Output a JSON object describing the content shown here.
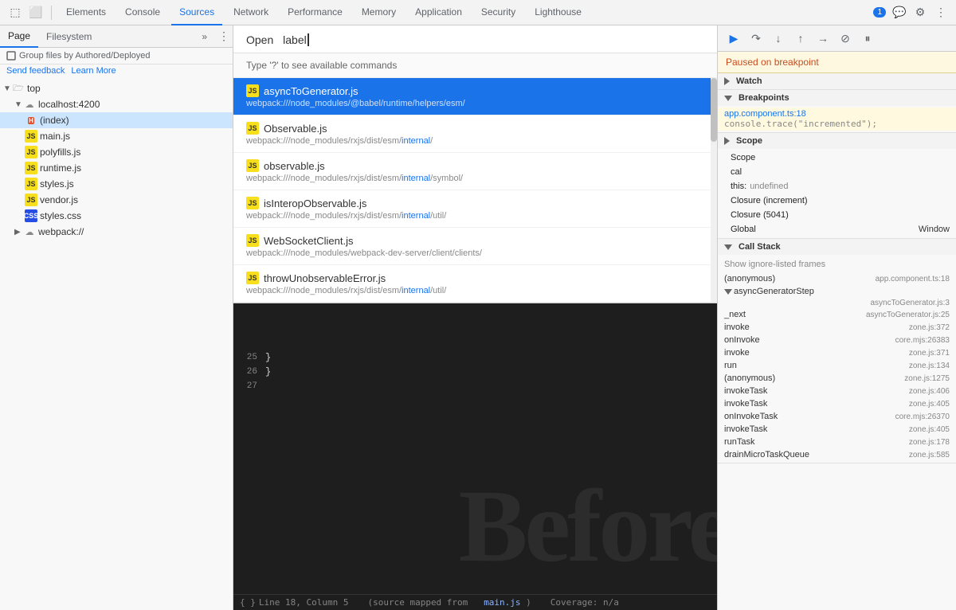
{
  "toolbar": {
    "tabs": [
      "Elements",
      "Console",
      "Sources",
      "Network",
      "Performance",
      "Memory",
      "Application",
      "Security",
      "Lighthouse"
    ],
    "active_tab": "Sources",
    "icons": {
      "inspect": "⬚",
      "device": "⬜",
      "settings": "⚙",
      "more": "⋮",
      "chat_badge": "1"
    }
  },
  "sidebar": {
    "tabs": [
      "Page",
      "Filesystem"
    ],
    "group_label": "Group files by Authored/Deployed",
    "send_feedback": "Send feedback",
    "learn_more": "Learn More",
    "tree": [
      {
        "id": "top",
        "label": "top",
        "level": 0,
        "type": "folder",
        "expanded": true
      },
      {
        "id": "localhost",
        "label": "localhost:4200",
        "level": 1,
        "type": "cloud",
        "expanded": true
      },
      {
        "id": "index",
        "label": "(index)",
        "level": 2,
        "type": "html",
        "selected": true
      },
      {
        "id": "main",
        "label": "main.js",
        "level": 2,
        "type": "js"
      },
      {
        "id": "polyfills",
        "label": "polyfills.js",
        "level": 2,
        "type": "js"
      },
      {
        "id": "runtime",
        "label": "runtime.js",
        "level": 2,
        "type": "js"
      },
      {
        "id": "styles",
        "label": "styles.js",
        "level": 2,
        "type": "js"
      },
      {
        "id": "vendor",
        "label": "vendor.js",
        "level": 2,
        "type": "js"
      },
      {
        "id": "stylescss",
        "label": "styles.css",
        "level": 2,
        "type": "css"
      },
      {
        "id": "webpack",
        "label": "webpack://",
        "level": 1,
        "type": "cloud",
        "expanded": false
      }
    ]
  },
  "file_open": {
    "label_open": "Open",
    "label_query": "label",
    "hint": "Type '?' to see available commands",
    "files": [
      {
        "name": "asyncToGenerator.js",
        "path": "webpack:///node_modules/@babel/runtime/helpers/esm/",
        "path_highlight": "",
        "selected": true
      },
      {
        "name": "Observable.js",
        "path": "webpack:///node_modules/rxjs/dist/esm/internal/",
        "path_highlight": "internal",
        "selected": false
      },
      {
        "name": "observable.js",
        "path": "webpack:///node_modules/rxjs/dist/esm/internal/symbol/",
        "path_highlight": "internal",
        "selected": false
      },
      {
        "name": "isInteropObservable.js",
        "path": "webpack:///node_modules/rxjs/dist/esm/internal/util/",
        "path_highlight": "internal",
        "selected": false
      },
      {
        "name": "WebSocketClient.js",
        "path": "webpack:///node_modules/webpack-dev-server/client/clients/",
        "path_highlight": "",
        "selected": false
      },
      {
        "name": "throwUnobservableError.js",
        "path": "webpack:///node_modules/rxjs/dist/esm/internal/util/",
        "path_highlight": "internal",
        "selected": false
      }
    ]
  },
  "source_code": {
    "lines": [
      {
        "num": "25",
        "code": "  }"
      },
      {
        "num": "26",
        "code": "}"
      },
      {
        "num": "27",
        "code": ""
      }
    ]
  },
  "status_bar": {
    "position": "Line 18, Column 5",
    "source_map": "(source mapped from",
    "source_file": "main.js",
    "coverage": "Coverage: n/a",
    "line_col": "{ }"
  },
  "debugger": {
    "paused_label": "Paused on breakpoint",
    "controls": [
      "resume",
      "step-over",
      "step-into",
      "step-out",
      "step",
      "deactivate",
      "pause"
    ],
    "sections": {
      "watch": {
        "label": "Watch"
      },
      "breakpoints": {
        "label": "Breakpoints",
        "items": [
          {
            "file": "app.component.ts:18",
            "code": "console.trace(\"incremented\");"
          }
        ]
      },
      "scope": {
        "label": "Scope",
        "items": [
          {
            "label": "Scope",
            "value": ""
          },
          {
            "label": "cal",
            "value": ""
          },
          {
            "label": "this:",
            "value": "undefined"
          },
          {
            "label": "Closure (increment)",
            "value": ""
          },
          {
            "label": "Closure (5041)",
            "value": ""
          },
          {
            "label": "Global",
            "value": "Window",
            "right": true
          }
        ]
      },
      "call_stack": {
        "label": "Call Stack",
        "ignore_label": "Show ignore-listed frames",
        "items": [
          {
            "name": "(anonymous)",
            "loc": "app.component.ts:18",
            "sub": false
          },
          {
            "name": "▼ asyncGeneratorStep",
            "expanded": true,
            "sub": false
          },
          {
            "name": "",
            "loc": "asyncToGenerator.js:3",
            "sub": true
          },
          {
            "name": "_next",
            "loc": "asyncToGenerator.js:25",
            "sub": false
          },
          {
            "name": "invoke",
            "loc": "zone.js:372",
            "sub": false
          },
          {
            "name": "onInvoke",
            "loc": "core.mjs:26383",
            "sub": false
          },
          {
            "name": "invoke",
            "loc": "zone.js:371",
            "sub": false
          },
          {
            "name": "run",
            "loc": "zone.js:134",
            "sub": false
          },
          {
            "name": "(anonymous)",
            "loc": "zone.js:1275",
            "sub": false
          },
          {
            "name": "invokeTask",
            "loc": "zone.js:406",
            "sub": false
          },
          {
            "name": "invokeTask",
            "loc": "zone.js:405",
            "sub": false
          },
          {
            "name": "onInvokeTask",
            "loc": "core.mjs:26370",
            "sub": false
          },
          {
            "name": "invokeTask",
            "loc": "zone.js:405",
            "sub": false
          },
          {
            "name": "runTask",
            "loc": "zone.js:178",
            "sub": false
          },
          {
            "name": "drainMicroTaskQueue",
            "loc": "zone.js:585",
            "sub": false
          }
        ]
      }
    }
  },
  "big_text": "Before"
}
